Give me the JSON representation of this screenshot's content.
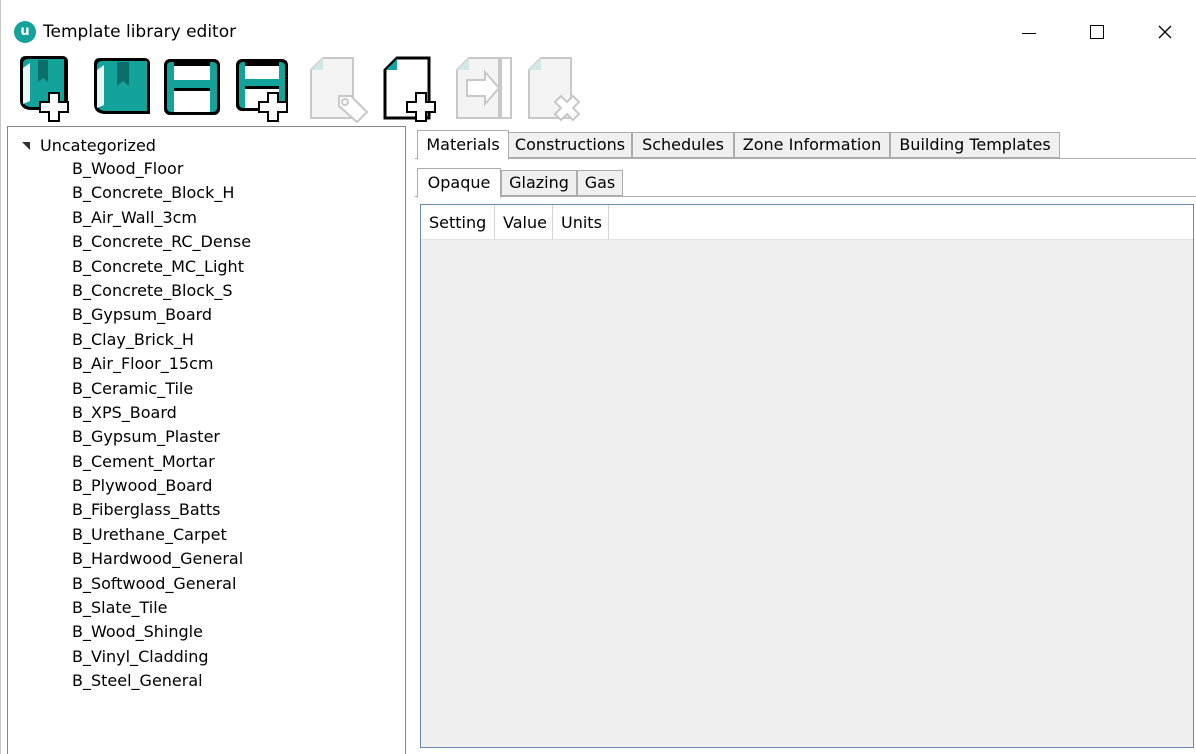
{
  "window": {
    "title": "Template library editor",
    "app_icon_glyph": "u",
    "app_icon": "ubem-logo-icon",
    "accent_color": "#13a39a"
  },
  "window_controls": {
    "minimize_icon": "minimize-icon",
    "maximize_icon": "maximize-icon",
    "close_icon": "close-icon"
  },
  "toolbar": {
    "buttons": [
      {
        "id": "new-library",
        "icon": "book-plus-icon",
        "enabled": true
      },
      {
        "id": "open-library",
        "icon": "book-icon",
        "enabled": true
      },
      {
        "id": "save",
        "icon": "floppy-icon",
        "enabled": true
      },
      {
        "id": "save-as",
        "icon": "floppy-plus-icon",
        "enabled": true
      },
      {
        "id": "tag",
        "icon": "document-tag-icon",
        "enabled": false
      },
      {
        "id": "new-item",
        "icon": "document-plus-icon",
        "enabled": true
      },
      {
        "id": "export",
        "icon": "document-arrow-icon",
        "enabled": false
      },
      {
        "id": "delete",
        "icon": "document-delete-icon",
        "enabled": false
      }
    ]
  },
  "tree": {
    "root_label": "Uncategorized",
    "expanded": true,
    "items": [
      "B_Wood_Floor",
      "B_Concrete_Block_H",
      "B_Air_Wall_3cm",
      "B_Concrete_RC_Dense",
      "B_Concrete_MC_Light",
      "B_Concrete_Block_S",
      "B_Gypsum_Board",
      "B_Clay_Brick_H",
      "B_Air_Floor_15cm",
      "B_Ceramic_Tile",
      "B_XPS_Board",
      "B_Gypsum_Plaster",
      "B_Cement_Mortar",
      "B_Plywood_Board",
      "B_Fiberglass_Batts",
      "B_Urethane_Carpet",
      "B_Hardwood_General",
      "B_Softwood_General",
      "B_Slate_Tile",
      "B_Wood_Shingle",
      "B_Vinyl_Cladding",
      "B_Steel_General"
    ]
  },
  "main_tabs": {
    "items": [
      "Materials",
      "Constructions",
      "Schedules",
      "Zone Information",
      "Building Templates"
    ],
    "selected": "Materials"
  },
  "sub_tabs": {
    "items": [
      "Opaque",
      "Glazing",
      "Gas"
    ],
    "selected": "Opaque"
  },
  "grid": {
    "columns": [
      "Setting",
      "Value",
      "Units"
    ],
    "rows": []
  }
}
